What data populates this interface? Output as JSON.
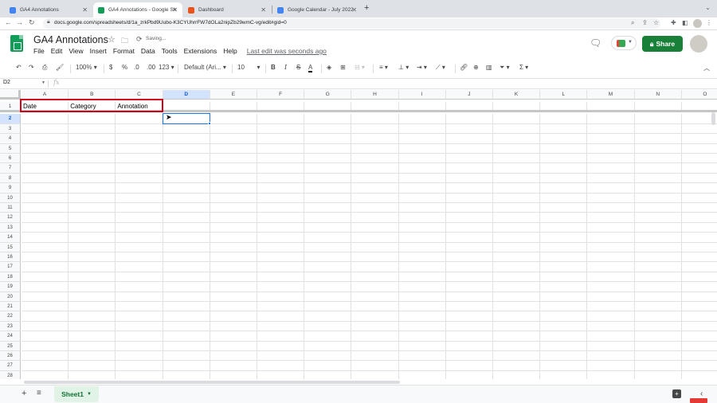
{
  "browser": {
    "tabs": [
      {
        "title": "GA4 Annotations",
        "favicon_color": "#4285f4",
        "active": false
      },
      {
        "title": "GA4 Annotations - Google Sh",
        "favicon_color": "#0f9d58",
        "active": true
      },
      {
        "title": "Dashboard",
        "favicon_color": "#e8531f",
        "active": false
      },
      {
        "title": "Google Calendar - July 2022",
        "favicon_color": "#4285f4",
        "active": false
      }
    ],
    "url": "docs.google.com/spreadsheets/d/1a_zrkPbd9Uubo-K3CYUhrrFW7dOLa2nipZb29wmC-vg/edit#gid=0"
  },
  "doc": {
    "title": "GA4 Annotations",
    "status": "Saving...",
    "menu": [
      "File",
      "Edit",
      "View",
      "Insert",
      "Format",
      "Data",
      "Tools",
      "Extensions",
      "Help"
    ],
    "last_edit": "Last edit was seconds ago",
    "share_label": "Share",
    "accent_color": "#188038"
  },
  "toolbar": {
    "zoom": "100%",
    "currency": "$",
    "percent": "%",
    "dec_decrease": ".0",
    "dec_increase": ".00",
    "number_format": "123",
    "font": "Default (Ari...",
    "font_size": "10",
    "bold": "B",
    "italic": "I",
    "text_color": "A"
  },
  "formula_bar": {
    "name_box": "D2",
    "fx": "fx"
  },
  "grid": {
    "columns": [
      "A",
      "B",
      "C",
      "D",
      "E",
      "F",
      "G",
      "H",
      "I",
      "J",
      "K",
      "L",
      "M",
      "N",
      "O"
    ],
    "rows": [
      "1",
      "2",
      "3",
      "4",
      "5",
      "6",
      "7",
      "8",
      "9",
      "10",
      "11",
      "12",
      "13",
      "14",
      "15",
      "16",
      "17",
      "18",
      "19",
      "20",
      "21",
      "22",
      "23",
      "24",
      "25",
      "26",
      "27",
      "28"
    ],
    "cells": {
      "A1": "Date",
      "B1": "Category",
      "C1": "Annotation"
    },
    "active_cell": "D2",
    "highlight_color": "#d0021b"
  },
  "sheets": [
    {
      "name": "Sheet1",
      "active": true
    }
  ]
}
